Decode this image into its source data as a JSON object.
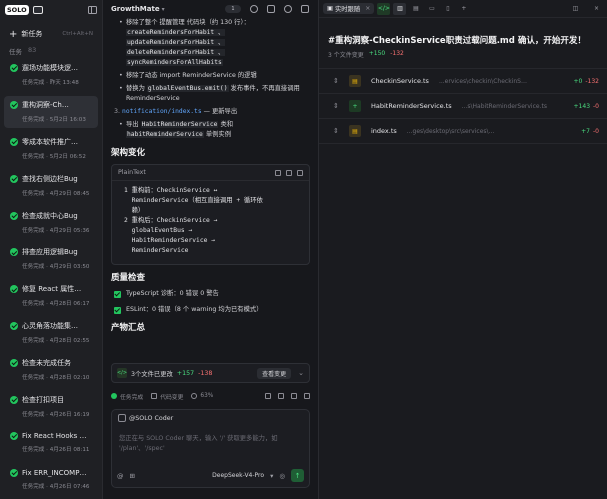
{
  "sidebar": {
    "logo": "SOLO",
    "new_task_label": "新任务",
    "new_task_shortcut": "Ctrl+Alt+N",
    "tasks_label": "任务",
    "tasks_count": "83",
    "tasks": [
      {
        "title": "遛场功能模块逻…",
        "sub": "任务完成 · 昨天 13:48",
        "active": false
      },
      {
        "title": "重构洞察-Ch…",
        "sub": "任务完成 · 5月2日 16:03",
        "active": true
      },
      {
        "title": "零成本软件推广…",
        "sub": "任务完成 · 5月2日 06:52",
        "active": false
      },
      {
        "title": "查找右侧边栏Bug",
        "sub": "任务完成 · 4月29日 08:45",
        "active": false
      },
      {
        "title": "检查成就中心Bug",
        "sub": "任务完成 · 4月29日 05:36",
        "active": false
      },
      {
        "title": "排查应用逻辑Bug",
        "sub": "任务完成 · 4月29日 03:50",
        "active": false
      },
      {
        "title": "修复 React 属性…",
        "sub": "任务完成 · 4月28日 06:17",
        "active": false
      },
      {
        "title": "心灵角落功能集…",
        "sub": "任务完成 · 4月28日 02:55",
        "active": false
      },
      {
        "title": "检查未完成任务",
        "sub": "任务完成 · 4月28日 02:10",
        "active": false
      },
      {
        "title": "检查打扣项目",
        "sub": "任务完成 · 4月26日 16:19",
        "active": false
      },
      {
        "title": "Fix React Hooks …",
        "sub": "任务完成 · 4月26日 08:11",
        "active": false
      },
      {
        "title": "Fix ERR_INCOMP…",
        "sub": "任务完成 · 4月26日 07:46",
        "active": false
      }
    ]
  },
  "chat": {
    "app_name": "GrowthMate",
    "header_badge": "1",
    "bullets_top": [
      {
        "text": "移除了整个 提醒管理 代码块（约 130 行）：",
        "codes": [
          "createRemindersForHabit 、",
          "updateRemindersForHabit 、",
          "deleteRemindersForHabit 、",
          "syncRemindersForAllHabits"
        ]
      },
      {
        "text": "移除了动态 import ReminderService 的逻辑"
      },
      {
        "pre": "替换为 ",
        "code": "globalEventBus.emit()",
        "post": " 发布事件，不再直接调用 ReminderService"
      }
    ],
    "item3_num": "3.",
    "item3_file": "notification/index.ts",
    "item3_desc": " — 更新导出",
    "item3_sub_pre": "导出 ",
    "item3_sub_code1": "HabitReminderService",
    "item3_sub_mid": " 类和",
    "item3_sub_code2": "habitReminderService",
    "item3_sub_post": " 单例实例",
    "arch_title": "架构变化",
    "codebox_lang": "PlainText",
    "codebox_lines": [
      "1 重构前：CheckinService ↔",
      "  ReminderService（相互直接调用 + 循环依",
      "  赖）",
      "2 重构后：CheckinService →",
      "  globalEventBus →",
      "  HabitReminderService →",
      "  ReminderService"
    ],
    "quality_title": "质量检查",
    "checks": [
      "TypeScript 诊断：0 错误 0 警告",
      "ESLint：0 错误（8 个 warning 均为已有模式）"
    ],
    "output_title": "产物汇总",
    "summary": {
      "label": "3个文件已更改",
      "added": "+157",
      "removed": "-138",
      "view_label": "查看变更"
    },
    "status": {
      "done": "任务完成",
      "changes": "代码变更",
      "percent": "63%"
    },
    "input": {
      "mention": "@SOLO Coder",
      "placeholder": "您正在与 SOLO Coder 聊天，输入 '/' 获取更多能力，如 '/plan'、'/spec'",
      "model": "DeepSeek-V4-Pro"
    }
  },
  "right": {
    "tab_label": "实时跟随",
    "title": "#重构洞察-CheckinService职责过载问题.md 确认，开始开发！",
    "meta_files": "3 个文件变更",
    "meta_added": "+150",
    "meta_removed": "-132",
    "files": [
      {
        "name": "CheckinService.ts",
        "path": "...ervices\\checkin\\CheckinService.ts",
        "added": "+0",
        "removed": "-132",
        "kind": "ts"
      },
      {
        "name": "HabitReminderService.ts",
        "path": "...s\\HabitReminderService.ts",
        "added": "+143",
        "removed": "-0",
        "kind": "new"
      },
      {
        "name": "index.ts",
        "path": "...ges\\desktop\\src\\services\\notification\\index.ts",
        "added": "+7",
        "removed": "-0",
        "kind": "ts"
      }
    ]
  }
}
